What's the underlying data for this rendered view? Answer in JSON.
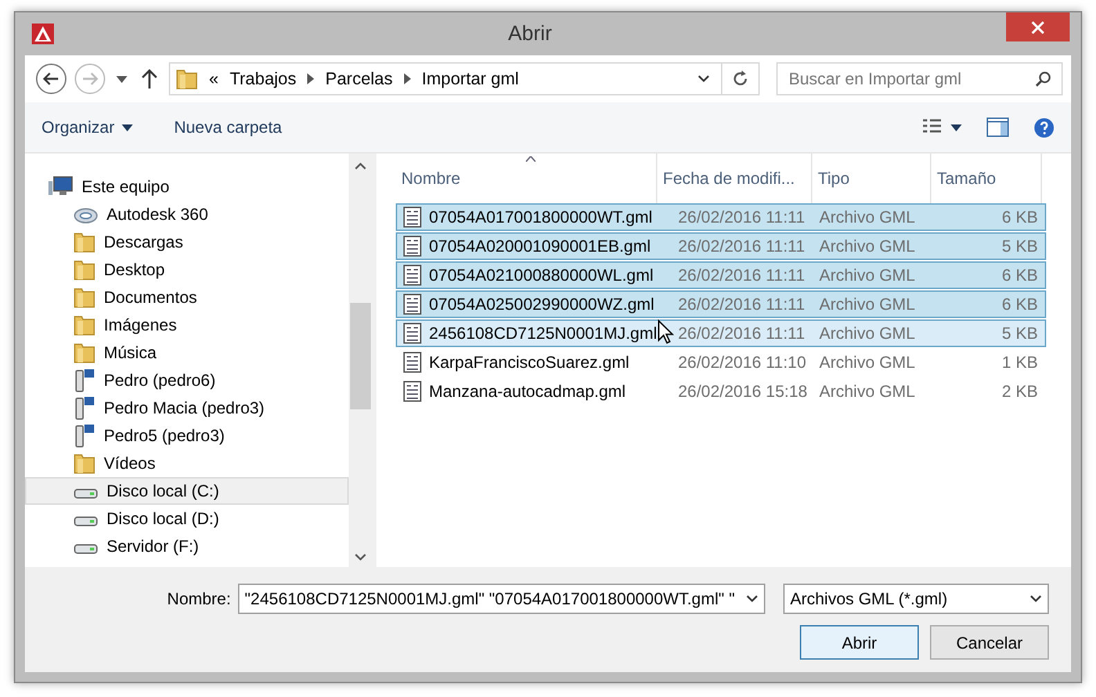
{
  "window": {
    "title": "Abrir"
  },
  "address": {
    "overflow": "«",
    "crumbs": [
      "Trabajos",
      "Parcelas",
      "Importar gml"
    ]
  },
  "search": {
    "placeholder": "Buscar en Importar gml"
  },
  "toolbar": {
    "organize": "Organizar",
    "new_folder": "Nueva carpeta"
  },
  "nav_items": [
    {
      "label": "Este equipo",
      "kind": "computer",
      "selected": false
    },
    {
      "label": "Autodesk 360",
      "kind": "cloud",
      "selected": false
    },
    {
      "label": "Descargas",
      "kind": "folder",
      "selected": false
    },
    {
      "label": "Desktop",
      "kind": "folder",
      "selected": false
    },
    {
      "label": "Documentos",
      "kind": "folder",
      "selected": false
    },
    {
      "label": "Imágenes",
      "kind": "folder",
      "selected": false
    },
    {
      "label": "Música",
      "kind": "folder",
      "selected": false
    },
    {
      "label": "Pedro (pedro6)",
      "kind": "network",
      "selected": false
    },
    {
      "label": "Pedro Macia (pedro3)",
      "kind": "network",
      "selected": false
    },
    {
      "label": "Pedro5 (pedro3)",
      "kind": "network",
      "selected": false
    },
    {
      "label": "Vídeos",
      "kind": "folder",
      "selected": false
    },
    {
      "label": "Disco local (C:)",
      "kind": "drive",
      "selected": true
    },
    {
      "label": "Disco local (D:)",
      "kind": "drive",
      "selected": false
    },
    {
      "label": "Servidor (F:)",
      "kind": "drive",
      "selected": false
    }
  ],
  "columns": [
    {
      "label": "Nombre",
      "sorted": true
    },
    {
      "label": "Fecha de modifi...",
      "sorted": false
    },
    {
      "label": "Tipo",
      "sorted": false
    },
    {
      "label": "Tamaño",
      "sorted": false
    }
  ],
  "files": [
    {
      "name": "07054A017001800000WT.gml",
      "date": "26/02/2016 11:11",
      "type": "Archivo GML",
      "size": "6 KB",
      "selected": true,
      "hovered": false
    },
    {
      "name": "07054A020001090001EB.gml",
      "date": "26/02/2016 11:11",
      "type": "Archivo GML",
      "size": "5 KB",
      "selected": true,
      "hovered": false
    },
    {
      "name": "07054A021000880000WL.gml",
      "date": "26/02/2016 11:11",
      "type": "Archivo GML",
      "size": "6 KB",
      "selected": true,
      "hovered": false
    },
    {
      "name": "07054A025002990000WZ.gml",
      "date": "26/02/2016 11:11",
      "type": "Archivo GML",
      "size": "6 KB",
      "selected": true,
      "hovered": false
    },
    {
      "name": "2456108CD7125N0001MJ.gml",
      "date": "26/02/2016 11:11",
      "type": "Archivo GML",
      "size": "5 KB",
      "selected": true,
      "hovered": true
    },
    {
      "name": "KarpaFranciscoSuarez.gml",
      "date": "26/02/2016 11:10",
      "type": "Archivo GML",
      "size": "1 KB",
      "selected": false,
      "hovered": false
    },
    {
      "name": "Manzana-autocadmap.gml",
      "date": "26/02/2016 15:18",
      "type": "Archivo GML",
      "size": "2 KB",
      "selected": false,
      "hovered": false
    }
  ],
  "filename": {
    "label": "Nombre:",
    "value": "\"2456108CD7125N0001MJ.gml\" \"07054A017001800000WT.gml\" \""
  },
  "filter": {
    "value": "Archivos GML (*.gml)"
  },
  "buttons": [
    {
      "label": "Abrir",
      "default": true
    },
    {
      "label": "Cancelar",
      "default": false
    }
  ]
}
